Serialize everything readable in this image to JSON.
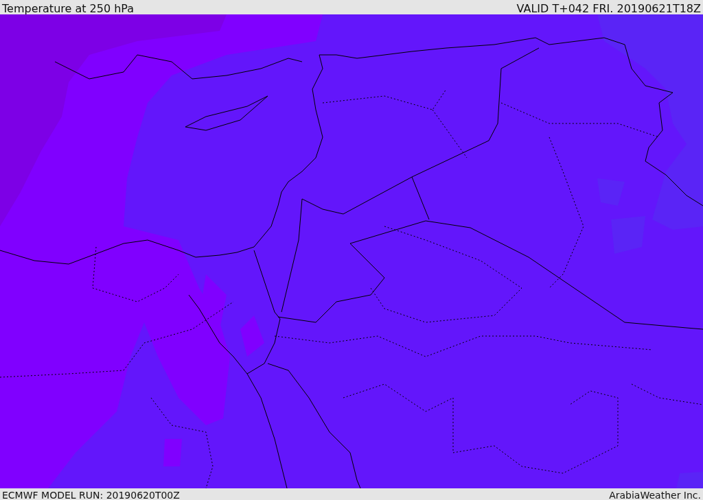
{
  "header": {
    "title": "Temperature at 250 hPa",
    "valid_time": "VALID T+042 FRI. 20190621T18Z"
  },
  "footer": {
    "model_run": "ECMWF MODEL RUN: 20190620T00Z",
    "credit": "ArabiaWeather Inc."
  }
}
